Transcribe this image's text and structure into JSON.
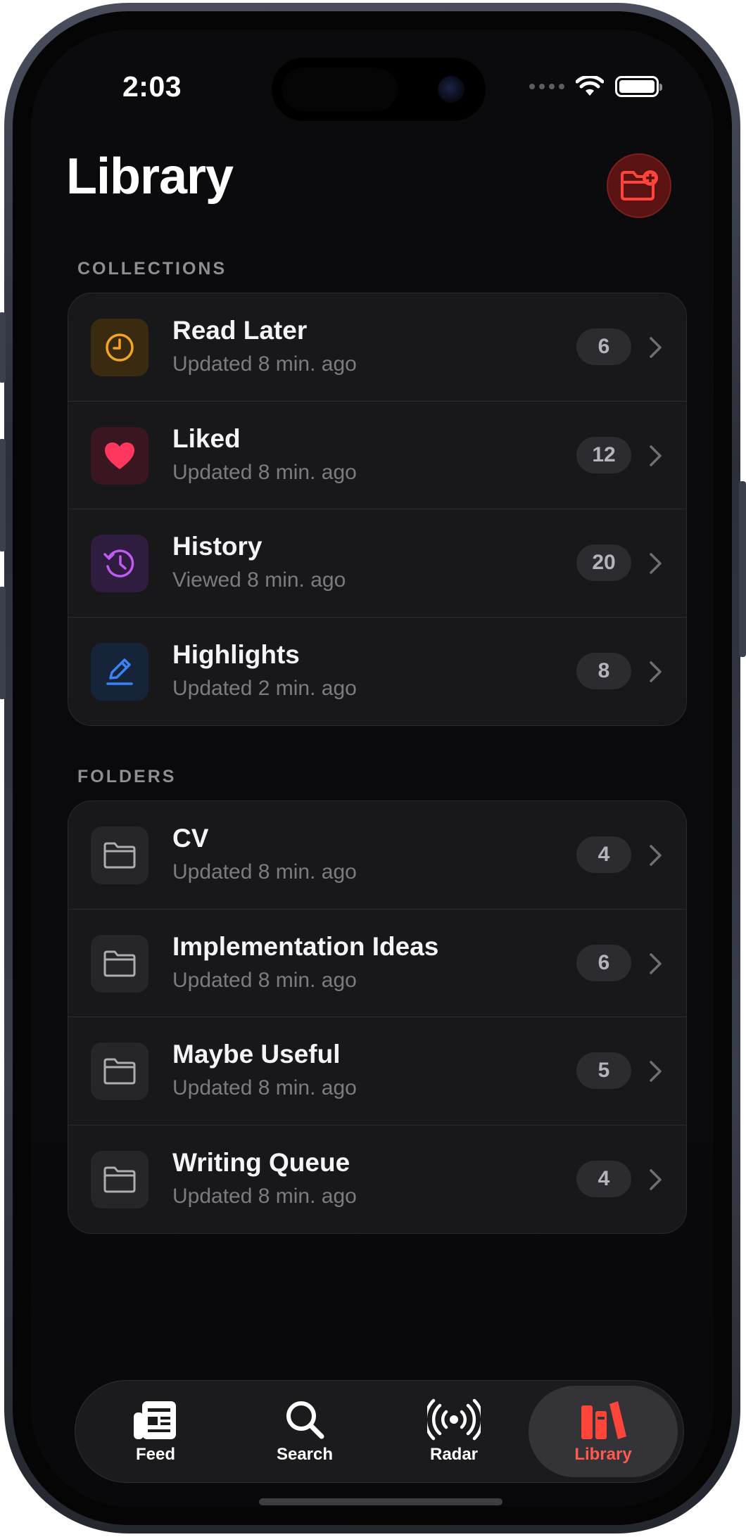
{
  "status_bar": {
    "time": "2:03"
  },
  "header": {
    "title": "Library"
  },
  "collections": {
    "label": "COLLECTIONS",
    "items": [
      {
        "title": "Read Later",
        "subtitle": "Updated 8 min. ago",
        "count": "6",
        "icon": "clock-icon",
        "color": "#f5a524"
      },
      {
        "title": "Liked",
        "subtitle": "Updated 8 min. ago",
        "count": "12",
        "icon": "heart-icon",
        "color": "#ff375f"
      },
      {
        "title": "History",
        "subtitle": "Viewed 8 min. ago",
        "count": "20",
        "icon": "history-icon",
        "color": "#bf5af2"
      },
      {
        "title": "Highlights",
        "subtitle": "Updated 2 min. ago",
        "count": "8",
        "icon": "pencil-icon",
        "color": "#3b82f6"
      }
    ]
  },
  "folders": {
    "label": "FOLDERS",
    "items": [
      {
        "title": "CV",
        "subtitle": "Updated 8 min. ago",
        "count": "4",
        "icon": "folder-icon"
      },
      {
        "title": "Implementation Ideas",
        "subtitle": "Updated 8 min. ago",
        "count": "6",
        "icon": "folder-icon"
      },
      {
        "title": "Maybe Useful",
        "subtitle": "Updated 8 min. ago",
        "count": "5",
        "icon": "folder-icon"
      },
      {
        "title": "Writing Queue",
        "subtitle": "Updated 8 min. ago",
        "count": "4",
        "icon": "folder-icon"
      }
    ]
  },
  "tabbar": {
    "tabs": [
      {
        "label": "Feed",
        "icon": "newspaper-icon"
      },
      {
        "label": "Search",
        "icon": "magnifier-icon"
      },
      {
        "label": "Radar",
        "icon": "broadcast-icon"
      },
      {
        "label": "Library",
        "icon": "books-icon",
        "active": true
      }
    ]
  },
  "colors": {
    "accent": "#ff453a"
  }
}
